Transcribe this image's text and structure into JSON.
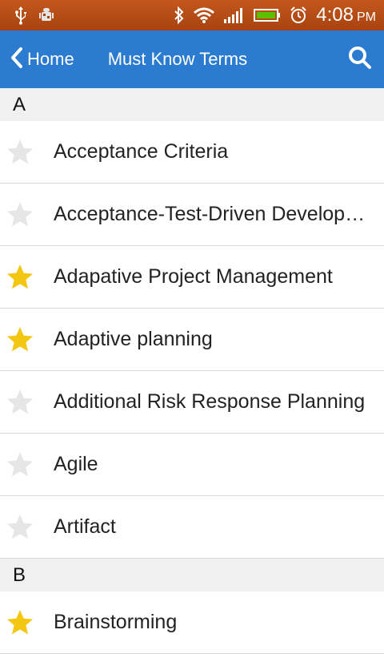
{
  "status_bar": {
    "time": "4:08",
    "ampm": "PM",
    "icons": [
      "usb-icon",
      "android-debug-icon",
      "bluetooth-icon",
      "wifi-icon",
      "signal-icon",
      "battery-icon",
      "alarm-icon"
    ]
  },
  "app_bar": {
    "back_label": "Home",
    "title": "Must Know Terms",
    "search_icon": "search-icon",
    "color": "#2b7bd0"
  },
  "sections": [
    {
      "letter": "A",
      "items": [
        {
          "label": "Acceptance Criteria",
          "starred": false
        },
        {
          "label": "Acceptance-Test-Driven Development",
          "starred": false
        },
        {
          "label": "Adapative Project Management",
          "starred": true
        },
        {
          "label": "Adaptive planning",
          "starred": true
        },
        {
          "label": "Additional Risk Response Planning",
          "starred": false
        },
        {
          "label": "Agile",
          "starred": false
        },
        {
          "label": "Artifact",
          "starred": false
        }
      ]
    },
    {
      "letter": "B",
      "items": [
        {
          "label": "Brainstorming",
          "starred": true
        }
      ]
    }
  ],
  "colors": {
    "star_on": "#f3c711",
    "star_off": "#e6e6e6"
  }
}
